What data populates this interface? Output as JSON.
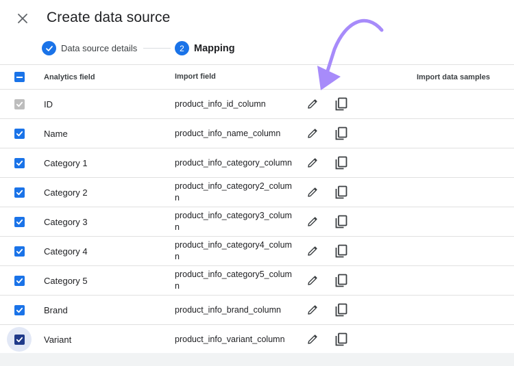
{
  "dialog": {
    "title": "Create data source"
  },
  "stepper": {
    "step1": {
      "label": "Data source details",
      "state": "completed"
    },
    "step2": {
      "number": "2",
      "label": "Mapping",
      "state": "active"
    }
  },
  "table": {
    "headers": {
      "analytics_field": "Analytics field",
      "import_field": "Import field",
      "samples": "Import data samples"
    },
    "rows": [
      {
        "field": "ID",
        "import": "product_info_id_column",
        "checked": true,
        "disabled": true
      },
      {
        "field": "Name",
        "import": "product_info_name_column",
        "checked": true
      },
      {
        "field": "Category 1",
        "import": "product_info_category_column",
        "checked": true
      },
      {
        "field": "Category 2",
        "import": "product_info_category2_column",
        "checked": true
      },
      {
        "field": "Category 3",
        "import": "product_info_category3_column",
        "checked": true
      },
      {
        "field": "Category 4",
        "import": "product_info_category4_column",
        "checked": true
      },
      {
        "field": "Category 5",
        "import": "product_info_category5_column",
        "checked": true
      },
      {
        "field": "Brand",
        "import": "product_info_brand_column",
        "checked": true
      },
      {
        "field": "Variant",
        "import": "product_info_variant_column",
        "checked": true,
        "focused": true
      }
    ]
  },
  "colors": {
    "accent": "#1a73e8",
    "annotation_arrow": "#a78bfa",
    "checkbox_disabled": "#bdbdbd"
  }
}
